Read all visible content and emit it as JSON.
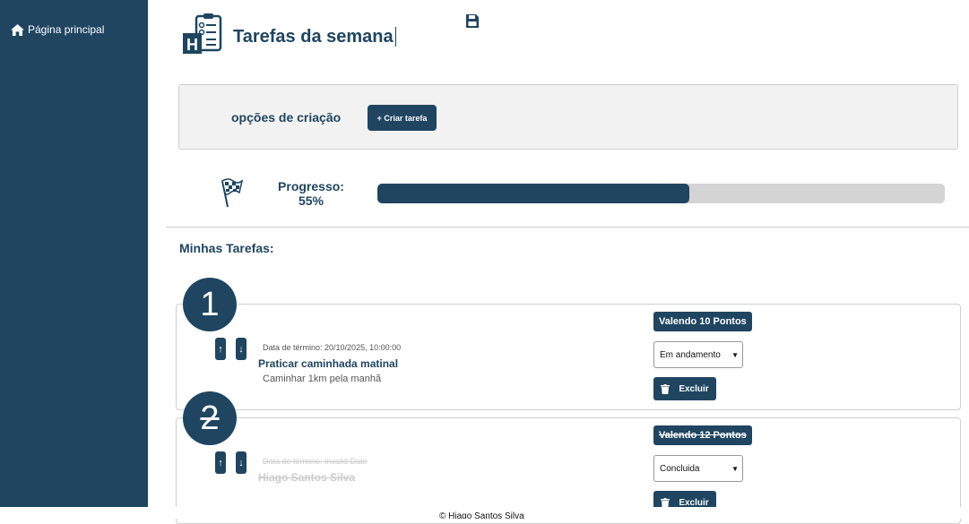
{
  "sidebar": {
    "home_label": "Página principal"
  },
  "header": {
    "title": "Tarefas da semana"
  },
  "options": {
    "label": "opções de criação",
    "create_button": "+ Criar tarefa"
  },
  "progress": {
    "label": "Progresso:",
    "value_text": "55%",
    "value": 0.55
  },
  "tasks_section": {
    "title": "Minhas Tarefas:"
  },
  "tasks": [
    {
      "number": "1",
      "date": "Data de término: 20/10/2025, 10:00:00",
      "title": "Praticar caminhada matinal",
      "description": "Caminhar 1km pela manhã",
      "points": "Valendo 10 Pontos",
      "status": "Em andamento",
      "delete_label": "Excluir",
      "completed": false
    },
    {
      "number": "2",
      "date": "Data de término: Invalid Date",
      "title": "Hiago Santos Silva",
      "description": "",
      "points": "Valendo 12 Pontos",
      "status": "Concluida",
      "delete_label": "Excluir",
      "completed": true
    }
  ],
  "footer": {
    "text": "© Hiago Santos Silva"
  },
  "colors": {
    "primary": "#1f4561",
    "panel": "#f2f2f2",
    "track": "#d4d4d4"
  }
}
